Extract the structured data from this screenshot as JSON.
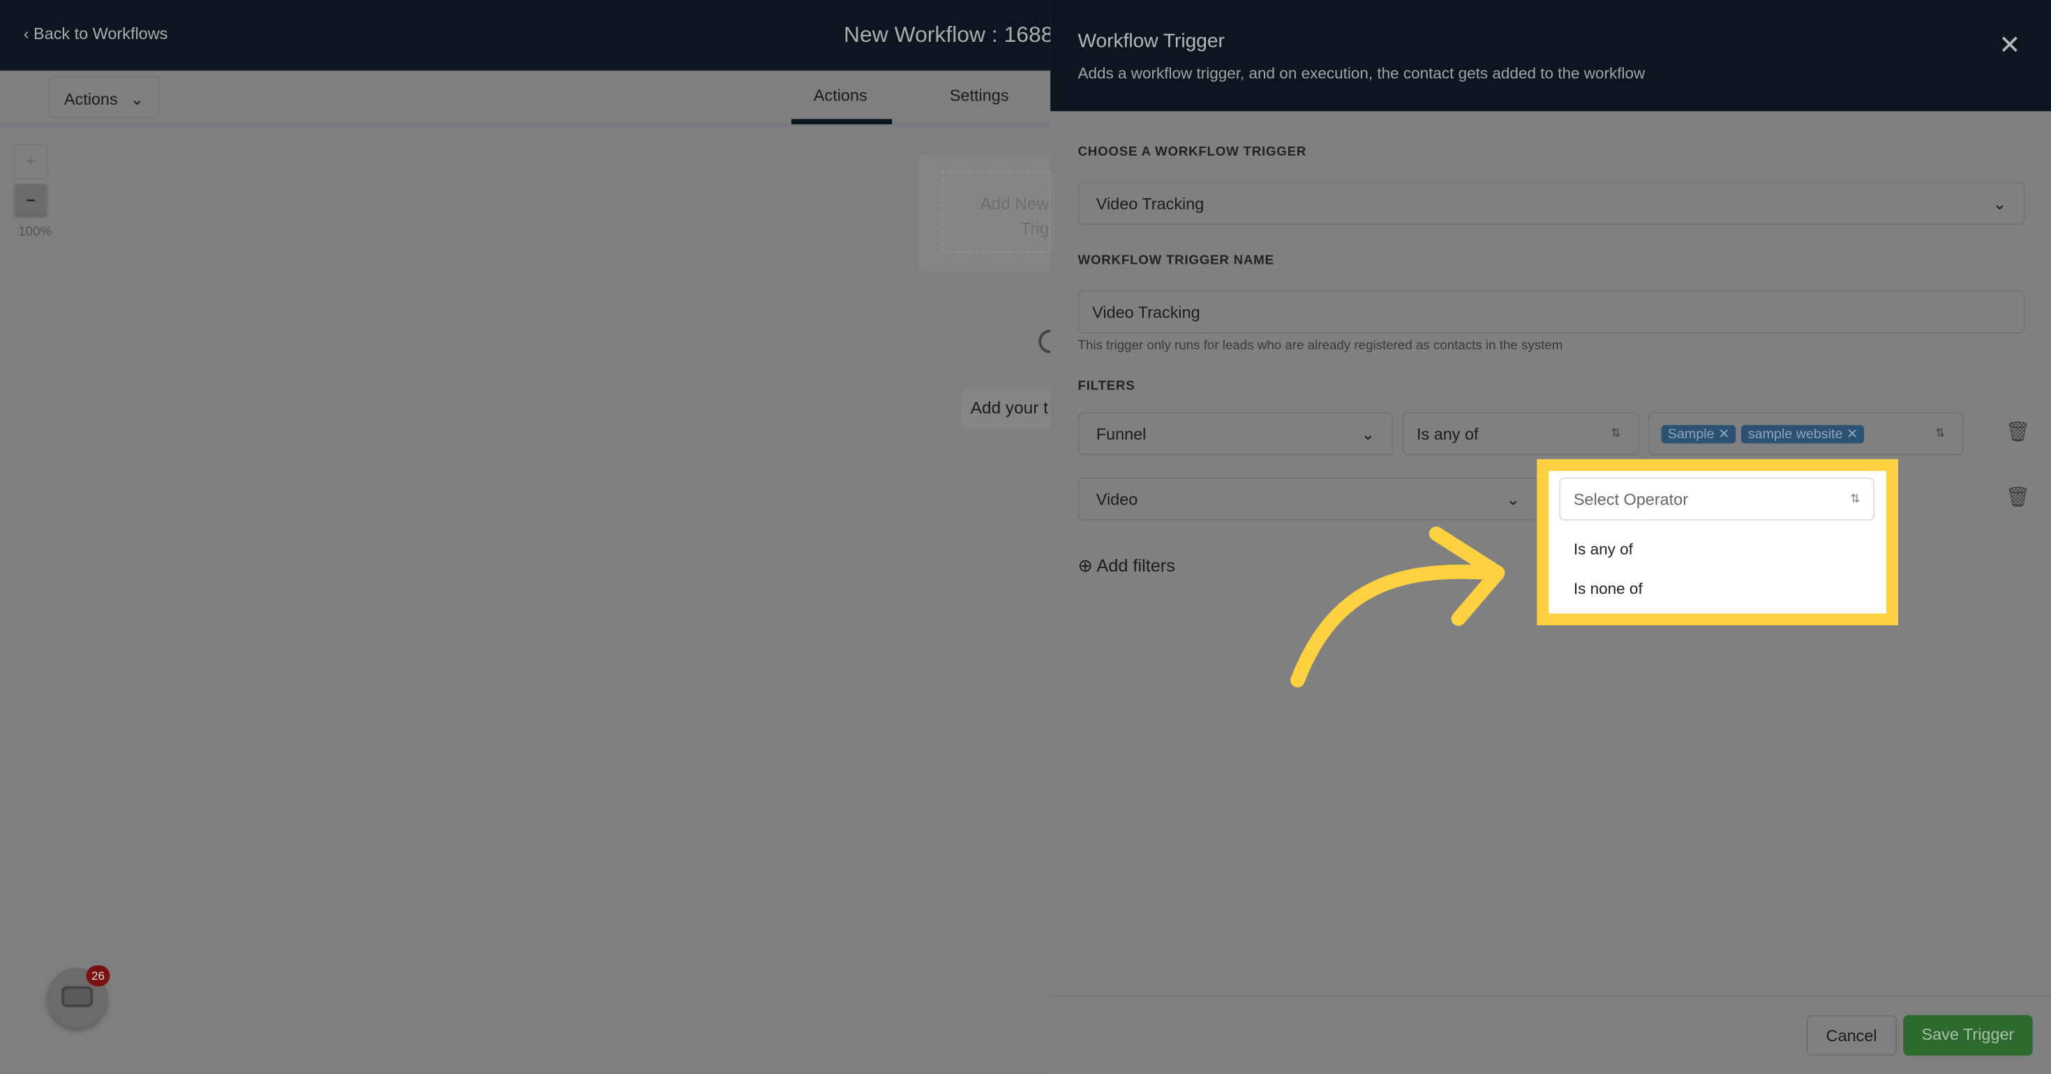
{
  "header": {
    "back_label": "Back to Workflows",
    "workflow_title": "New Workflow : 1688"
  },
  "toolbar": {
    "actions_dropdown": "Actions",
    "tabs": [
      {
        "label": "Actions",
        "active": true
      },
      {
        "label": "Settings",
        "active": false
      }
    ]
  },
  "canvas": {
    "zoom_in": "+",
    "zoom_out": "−",
    "zoom_level": "100%",
    "add_trigger_card": "Add New\nTrig",
    "add_your": "Add your t"
  },
  "panel": {
    "title": "Workflow Trigger",
    "subtitle": "Adds a workflow trigger, and on execution, the contact gets added to the workflow",
    "choose_label": "CHOOSE A WORKFLOW TRIGGER",
    "trigger_value": "Video Tracking",
    "name_label": "WORKFLOW TRIGGER NAME",
    "name_value": "Video Tracking",
    "hint": "This trigger only runs for leads who are already registered as contacts in the system",
    "filters_label": "FILTERS",
    "filters": [
      {
        "field": "Funnel",
        "operator": "Is any of",
        "values": [
          "Sample",
          "sample website"
        ]
      },
      {
        "field": "Video",
        "operator_placeholder": "Select Operator",
        "options": [
          "Is any of",
          "Is none of"
        ]
      }
    ],
    "add_filters": "Add filters",
    "cancel": "Cancel",
    "save": "Save Trigger"
  },
  "chat": {
    "badge_count": "26"
  },
  "colors": {
    "highlight": "#fdd13f",
    "header": "#0c1620",
    "save": "#2e6a2e",
    "chip": "#2b5173"
  }
}
